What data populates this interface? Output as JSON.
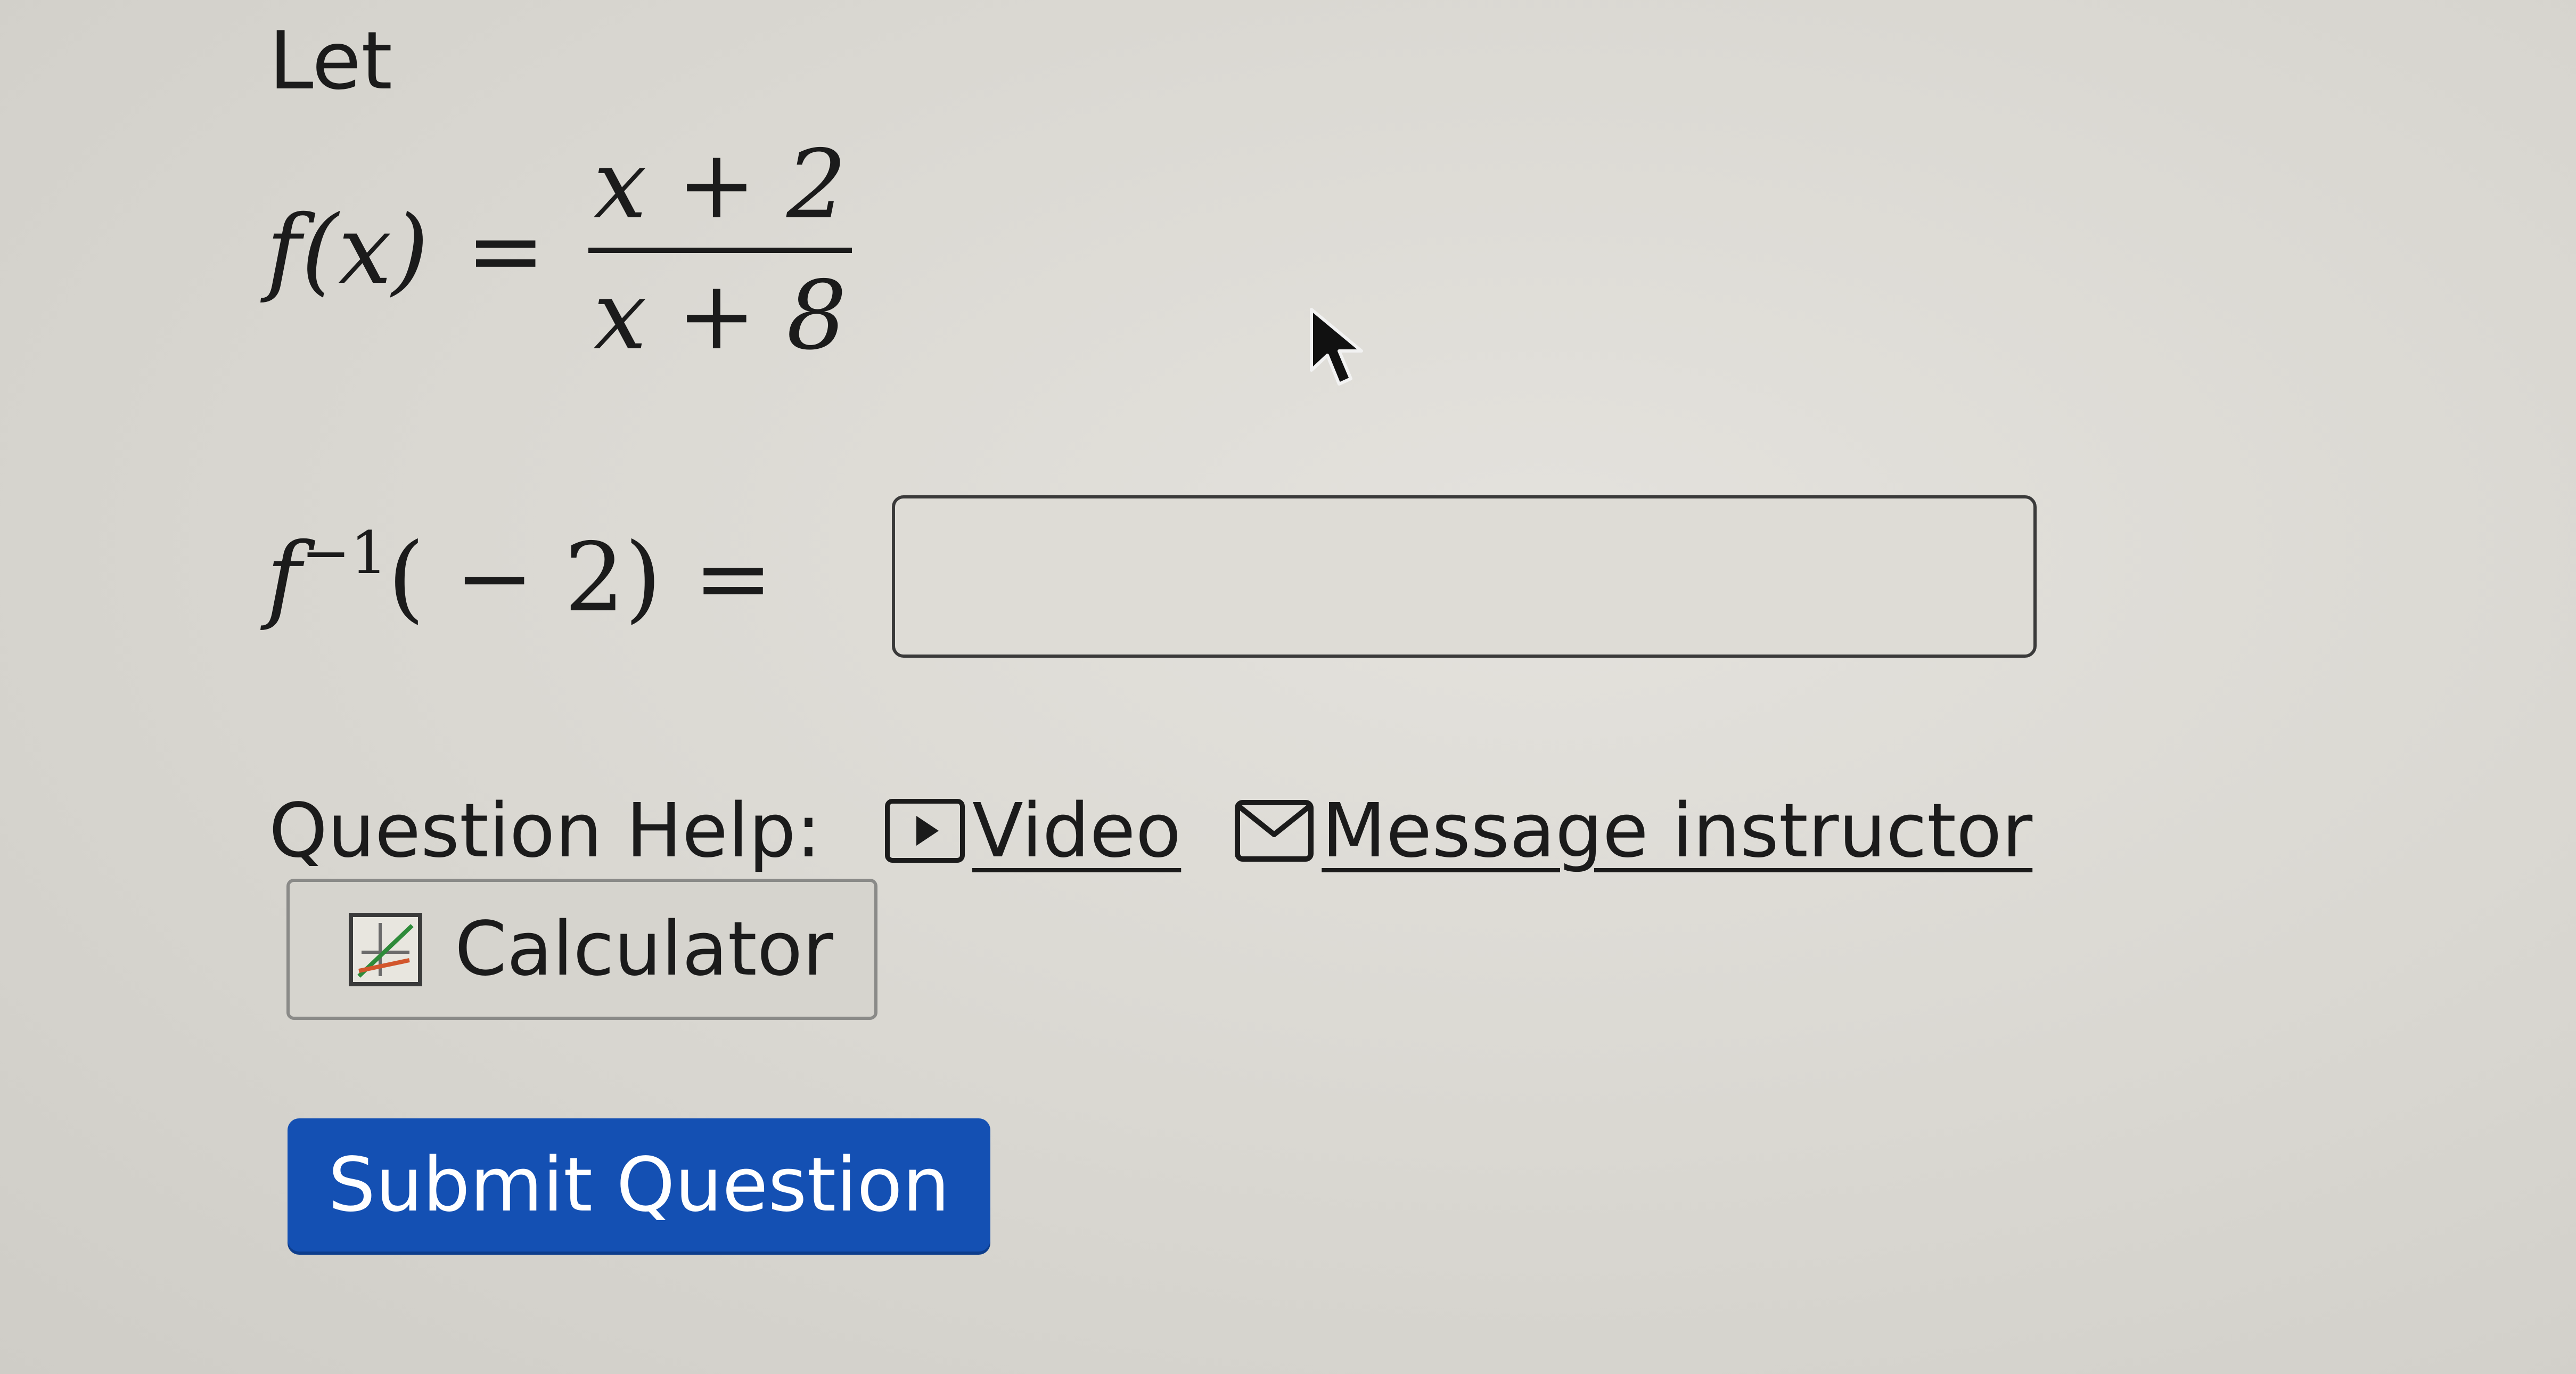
{
  "question": {
    "intro": "Let",
    "function_def": {
      "lhs_name": "f",
      "lhs_arg": "(x)",
      "equals": "=",
      "numerator": "x + 2",
      "denominator": "x + 8"
    },
    "inverse_eval": {
      "name": "f",
      "superscript": "−1",
      "argument": "( − 2)",
      "equals": "="
    },
    "answer": {
      "value": "",
      "placeholder": ""
    }
  },
  "help": {
    "label": "Question Help:",
    "video_label": "Video",
    "message_label": "Message instructor",
    "calculator_label": "Calculator"
  },
  "actions": {
    "submit_label": "Submit Question"
  },
  "icons": {
    "video": "play-box-icon",
    "message": "envelope-icon",
    "calculator": "calculator-graph-icon",
    "cursor": "mouse-pointer-icon"
  },
  "colors": {
    "submit_background": "#1450b3",
    "submit_text": "#ffffff",
    "page_background": "#dcdad4",
    "text": "#1b1b1b"
  }
}
